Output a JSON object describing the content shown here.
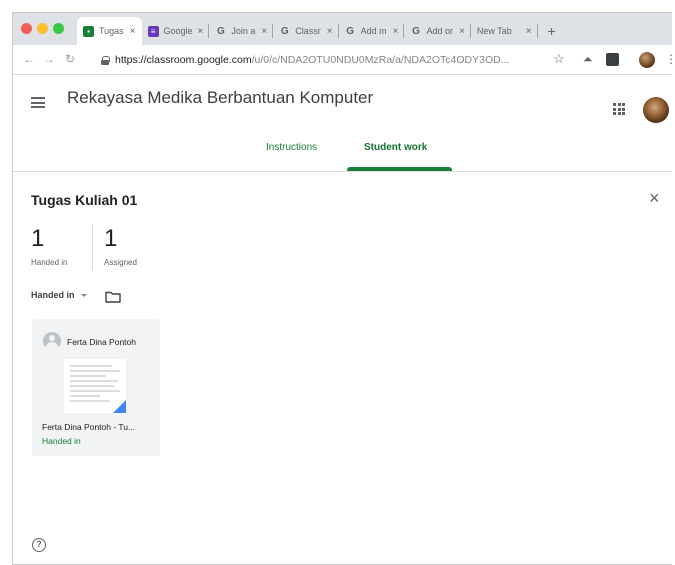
{
  "browser": {
    "tabs": [
      {
        "title": "Tugas",
        "favicon": "classroom-icon",
        "color": "#188038",
        "active": true
      },
      {
        "title": "Google",
        "favicon": "forms-icon",
        "color": "#673ab7",
        "active": false
      },
      {
        "title": "Join a",
        "favicon": "google-g-icon",
        "active": false
      },
      {
        "title": "Classr",
        "favicon": "google-g-icon",
        "active": false
      },
      {
        "title": "Add m",
        "favicon": "google-g-icon",
        "active": false
      },
      {
        "title": "Add or",
        "favicon": "google-g-icon",
        "active": false
      },
      {
        "title": "New Tab",
        "favicon": "",
        "active": false
      }
    ],
    "tab_close_glyph": "×",
    "new_tab_glyph": "+",
    "url_host": "https://classroom.google.com",
    "url_path": "/u/0/c/NDA2OTU0NDU0MzRa/a/NDA2OTc4ODY3OD..."
  },
  "app": {
    "class_title": "Rekayasa Medika Berbantuan Komputer",
    "tabs": {
      "instructions": "Instructions",
      "student_work": "Student work",
      "active": "student_work"
    },
    "accent": "#188038"
  },
  "assignment": {
    "title": "Tugas Kuliah 01",
    "handed_in_count": "1",
    "handed_in_label": "Handed in",
    "assigned_count": "1",
    "assigned_label": "Assigned",
    "filter_label": "Handed in"
  },
  "submissions": [
    {
      "student": "Ferta Dina Pontoh",
      "file": "Ferta Dina Pontoh - Tu...",
      "status": "Handed in"
    }
  ]
}
